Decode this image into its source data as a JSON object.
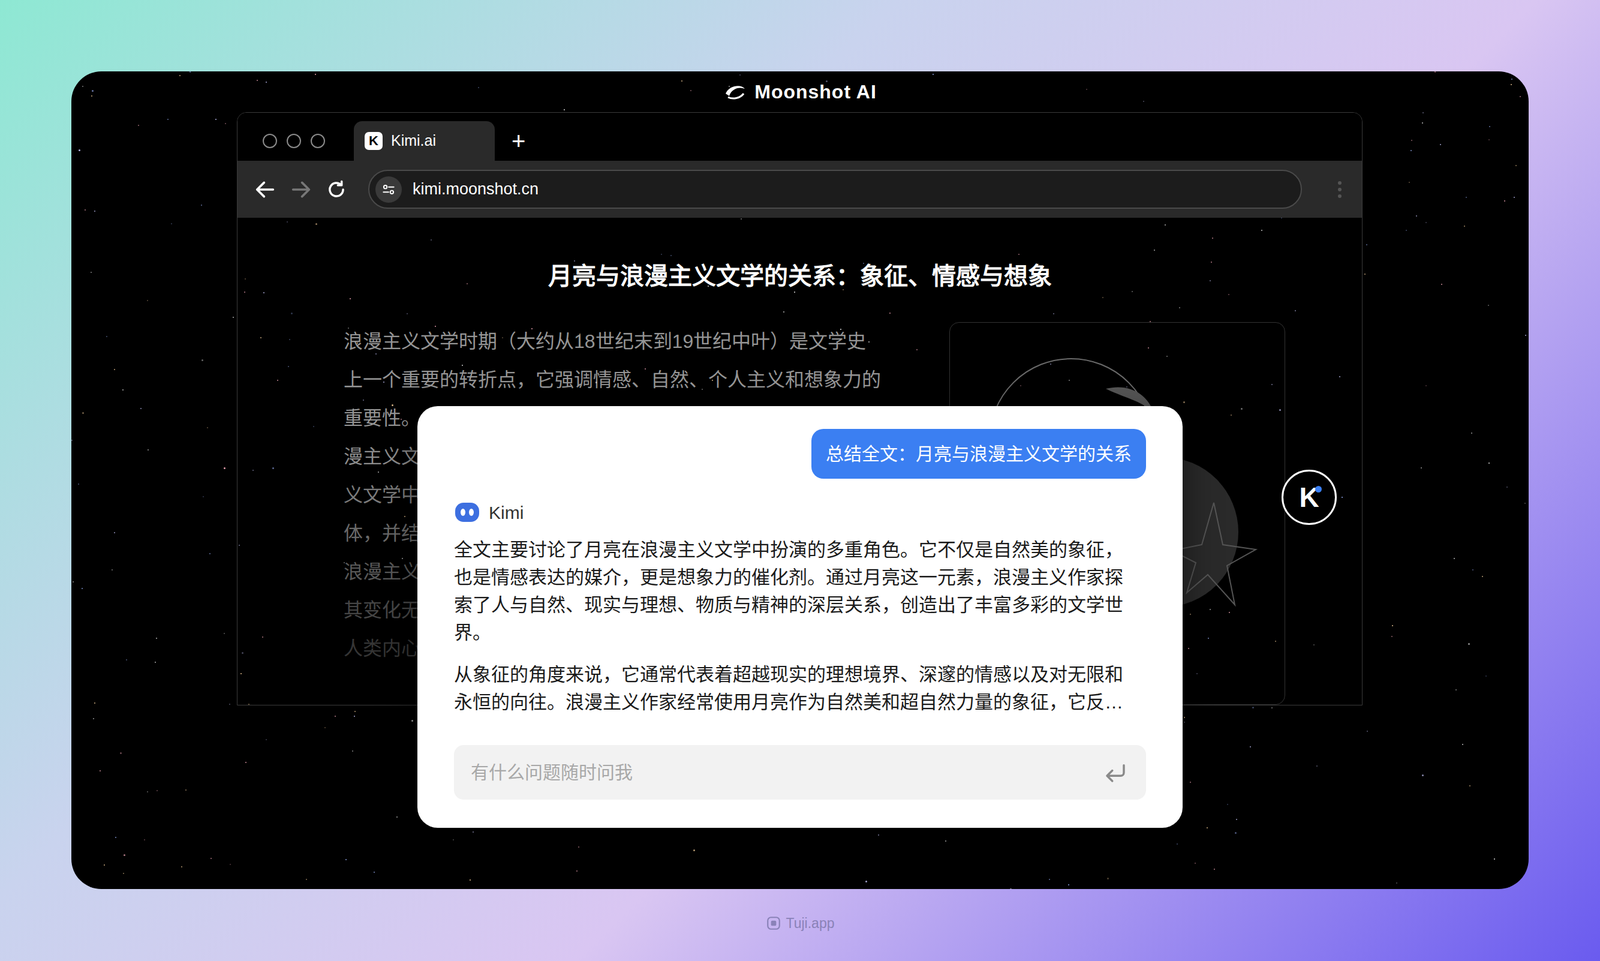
{
  "brand": {
    "name": "Moonshot AI"
  },
  "browser": {
    "tabs": [
      {
        "label": "Kimi.ai",
        "logo": "K",
        "selected": true
      }
    ],
    "new_tab": "+",
    "nav": {
      "back_enabled": true,
      "forward_enabled": false
    },
    "address": "kimi.moonshot.cn"
  },
  "article": {
    "title": "月亮与浪漫主义文学的关系：象征、情感与想象",
    "lines": [
      "浪漫主义文学时期（大约从18世纪末到19世纪中叶）是文学史",
      "上一个重要的转折点，它强调情感、自然、个人主义和想象力的",
      "重要性。",
      "漫主义文",
      "义文学中",
      "体，并结",
      "浪漫主义",
      "其变化无",
      "人类内心"
    ]
  },
  "chat": {
    "user_message": "总结全文：月亮与浪漫主义文学的关系",
    "assistant": {
      "name": "Kimi",
      "paragraphs": [
        {
          "lines": [
            "全文主要讨论了月亮在浪漫主义文学中扮演的多重角色。它不仅是自然美的象征，",
            "也是情感表达的媒介，更是想象力的催化剂。通过月亮这一元素，浪漫主义作家探",
            "索了人与自然、现实与理想、物质与精神的深层关系，创造出了丰富多彩的文学世",
            "界。"
          ]
        },
        {
          "lines": [
            "从象征的角度来说，它通常代表着超越现实的理想境界、深邃的情感以及对无限和",
            "永恒的向往。浪漫主义作家经常使用月亮作为自然美和超自然力量的象征，它反…"
          ]
        }
      ]
    },
    "input": {
      "placeholder": "有什么问题随时问我"
    }
  },
  "floating_button": {
    "logo": "K"
  },
  "watermark": "Tuji.app"
}
